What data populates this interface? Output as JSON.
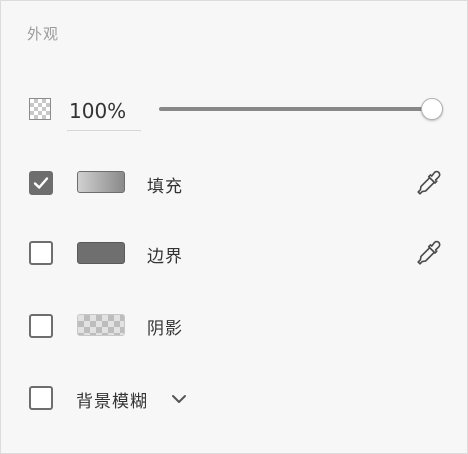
{
  "panel": {
    "title": "外观"
  },
  "opacity": {
    "value": "100%",
    "slider_percent": 100,
    "icon": "transparency-checker-icon"
  },
  "rows": {
    "fill": {
      "label": "填充",
      "checked": true,
      "swatch": "gradient-gray",
      "icon": "eyedropper-icon"
    },
    "border": {
      "label": "边界",
      "checked": false,
      "swatch": "solid-gray",
      "icon": "eyedropper-icon"
    },
    "shadow": {
      "label": "阴影",
      "checked": false,
      "swatch": "checker-gray"
    },
    "blur": {
      "label": "背景模糊",
      "checked": false,
      "icon": "chevron-down-icon"
    }
  },
  "colors": {
    "checkbox": "#6e6e6e",
    "text": "#333333",
    "muted": "#9b9b9b",
    "background": "#f7f7f7"
  }
}
